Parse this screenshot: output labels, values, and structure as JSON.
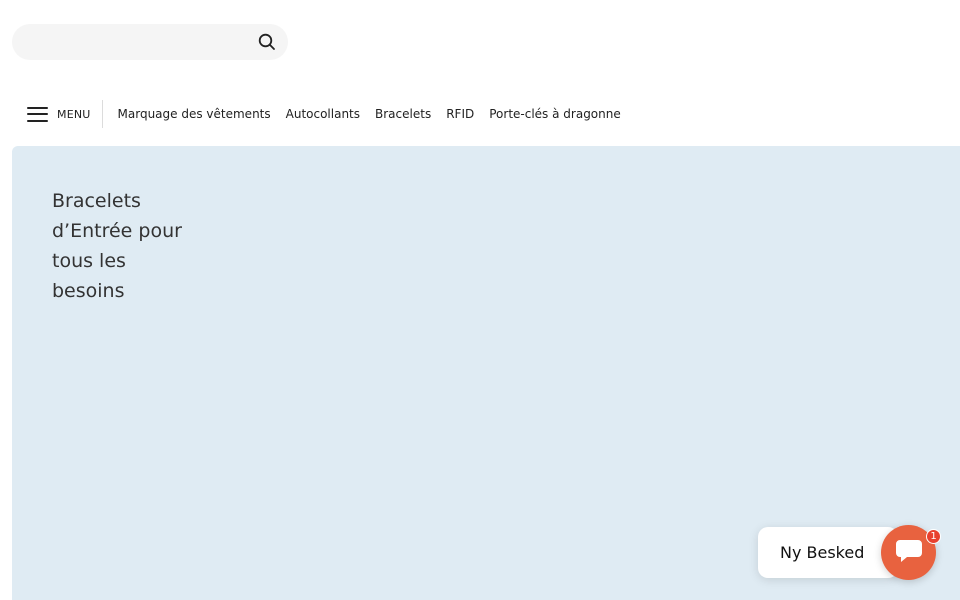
{
  "search": {
    "value": "",
    "placeholder": "",
    "icon": "search-icon"
  },
  "nav": {
    "menu_label": "MENU",
    "menu_icon": "hamburger-icon",
    "links": [
      {
        "label": "Marquage des vêtements"
      },
      {
        "label": "Autocollants"
      },
      {
        "label": "Bracelets"
      },
      {
        "label": "RFID"
      },
      {
        "label": "Porte-clés à dragonne"
      }
    ]
  },
  "hero": {
    "title": "Bracelets d’Entrée pour tous les besoins",
    "background_color": "#dfebf3"
  },
  "chat": {
    "bubble_text": "Ny Besked",
    "badge_count": "1",
    "icon": "chat-icon",
    "accent_color": "#e8623f"
  }
}
